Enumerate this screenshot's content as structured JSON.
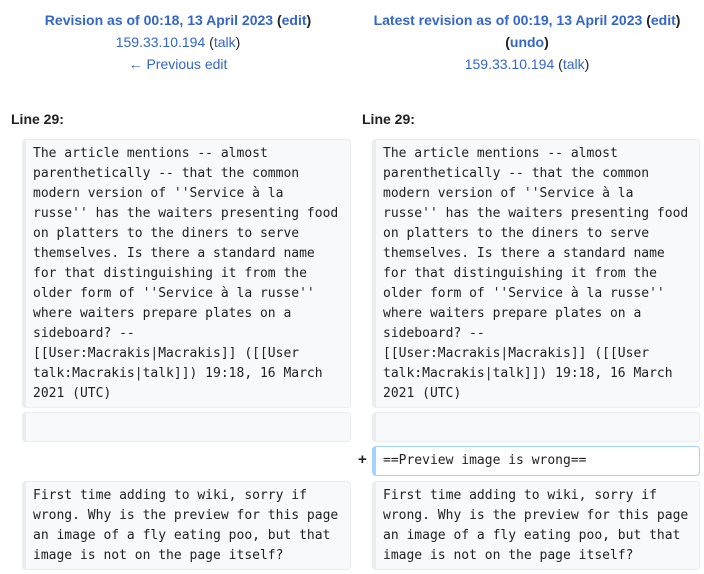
{
  "left_header": {
    "revision_label": "Revision as of 00:18, 13 April 2023",
    "edit_label": "edit",
    "user": "159.33.10.194",
    "talk_label": "talk",
    "previous_edit": "← Previous edit"
  },
  "right_header": {
    "revision_label": "Latest revision as of 00:19, 13 April 2023",
    "edit_label": "edit",
    "undo_label": "undo",
    "user": "159.33.10.194",
    "talk_label": "talk"
  },
  "diff": {
    "left_line": "Line 29:",
    "right_line": "Line 29:",
    "para1": "The article mentions -- almost parenthetically -- that the common modern version of ''Service à la russe'' has the waiters presenting food on platters to the diners to serve themselves. Is there a standard name for that distinguishing it from the older form of ''Service à la russe'' where waiters prepare plates on a sideboard? -- [[User:Macrakis|Macrakis]] ([[User talk:Macrakis|talk]]) 19:18, 16 March 2021 (UTC)",
    "added_marker": "+",
    "added_line": "==Preview image is wrong==",
    "para2": "First time adding to wiki, sorry if wrong. Why is the preview for this page an image of a fly eating poo, but that image is not on the page itself?"
  }
}
